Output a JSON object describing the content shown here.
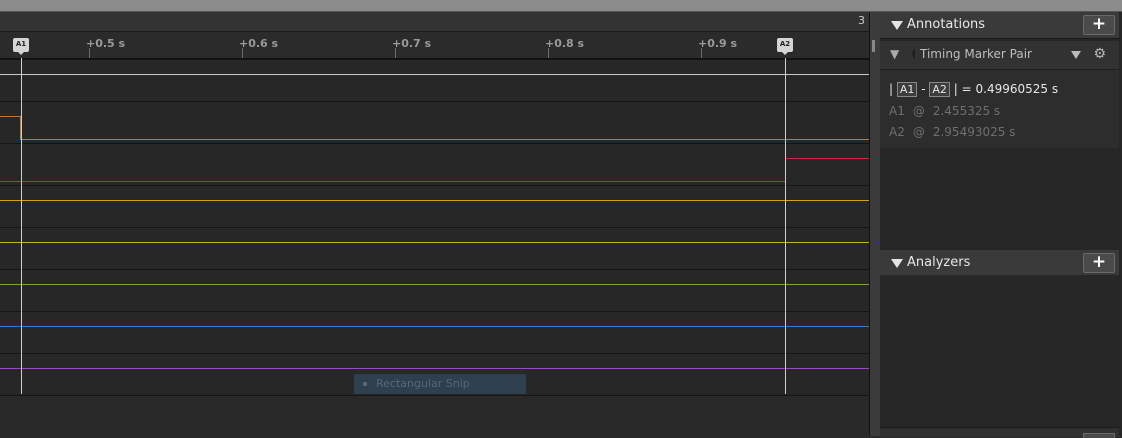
{
  "colors": {
    "channel_signal": [
      "#c8c8c8",
      "#c07a30",
      "#d02a3a",
      "#d8a020",
      "#c8b418",
      "#7aa82a",
      "#3a78c8",
      "#a048c0"
    ]
  },
  "waveform": {
    "page_indicator": "3",
    "ruler_ticks": [
      "+0.5 s",
      "+0.6 s",
      "+0.7 s",
      "+0.8 s",
      "+0.9 s"
    ],
    "marker_a1": "A1",
    "marker_a2": "A2",
    "snip_label": "Rectangular Snip"
  },
  "annotations": {
    "title": "Annotations",
    "add_label": "+",
    "marker_pair": {
      "name": "Timing Marker Pair",
      "pin_icon": "pin-icon",
      "gear_icon": "gear-icon",
      "delta_prefix": "|",
      "tag_a1": "A1",
      "dash": "-",
      "tag_a2": "A2",
      "delta_suffix": "| =",
      "delta_value": "0.49960525 s",
      "a1_label": "A1",
      "a1_at": "@",
      "a1_time": "2.455325 s",
      "a2_label": "A2",
      "a2_at": "@",
      "a2_time": "2.95493025 s"
    }
  },
  "analyzers": {
    "title": "Analyzers",
    "add_label": "+"
  }
}
